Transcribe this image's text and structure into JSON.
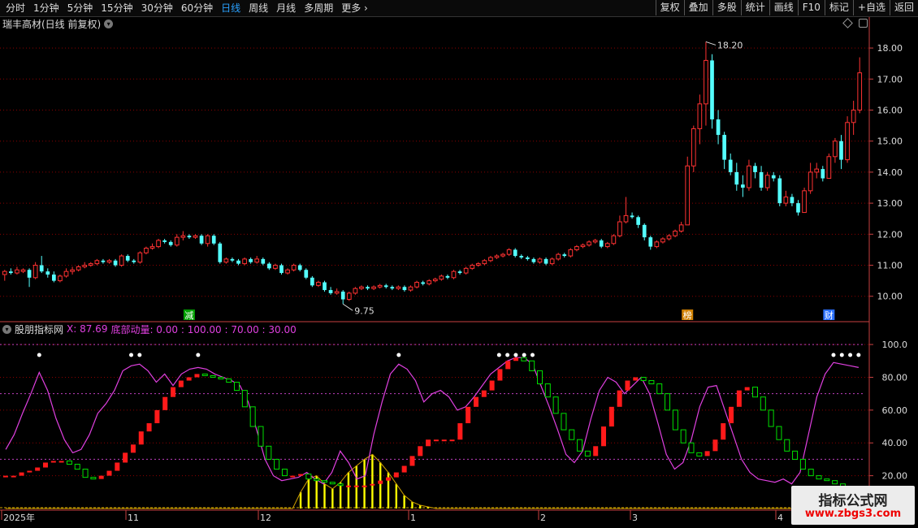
{
  "toolbar": {
    "periods": [
      "分时",
      "1分钟",
      "5分钟",
      "15分钟",
      "30分钟",
      "60分钟",
      "日线",
      "周线",
      "月线",
      "多周期",
      "更多"
    ],
    "active_index": 6,
    "buttons": [
      "复权",
      "叠加",
      "多股",
      "统计",
      "画线",
      "F10",
      "标记",
      "+自选",
      "返回"
    ]
  },
  "stock": {
    "title": "瑞丰高材(日线 前复权)"
  },
  "indicator": {
    "name": "股朋指标网",
    "x_label": "X: 87.69",
    "params_label": "底部动量: 0.00 : 100.00 : 70.00 : 30.00"
  },
  "colors": {
    "up": "#ff3232",
    "down": "#54ffff",
    "green": "#00e000",
    "magenta": "#e040e0",
    "yellow": "#ffff00",
    "grid": "#8b0000",
    "axis": "#c84040"
  },
  "chart_data": [
    {
      "type": "candlestick",
      "title": "瑞丰高材(日线 前复权)",
      "y_ticks": [
        "10.00",
        "11.00",
        "12.00",
        "13.00",
        "14.00",
        "15.00",
        "16.00",
        "17.00",
        "18.00"
      ],
      "ylim": [
        9.6,
        18.5
      ],
      "annotations": {
        "high": "18.20",
        "low": "9.75"
      },
      "markers": [
        "减",
        "榜",
        "财"
      ],
      "candles": [
        [
          10.7,
          10.8,
          10.5,
          10.85
        ],
        [
          10.8,
          10.75,
          10.7,
          10.9
        ],
        [
          10.75,
          10.85,
          10.7,
          10.95
        ],
        [
          10.8,
          10.85,
          10.75,
          10.9
        ],
        [
          10.85,
          10.6,
          10.3,
          10.9
        ],
        [
          10.6,
          11.0,
          10.55,
          11.1
        ],
        [
          11.0,
          10.8,
          10.75,
          11.3
        ],
        [
          10.8,
          10.7,
          10.6,
          10.9
        ],
        [
          10.7,
          10.5,
          10.45,
          10.8
        ],
        [
          10.5,
          10.65,
          10.45,
          10.7
        ],
        [
          10.65,
          10.8,
          10.6,
          10.9
        ],
        [
          10.8,
          10.85,
          10.7,
          10.95
        ],
        [
          10.85,
          10.95,
          10.8,
          11.0
        ],
        [
          10.95,
          11.0,
          10.9,
          11.1
        ],
        [
          11.0,
          11.05,
          10.95,
          11.1
        ],
        [
          11.05,
          11.15,
          11.0,
          11.2
        ],
        [
          11.15,
          11.1,
          11.05,
          11.2
        ],
        [
          11.1,
          11.15,
          11.05,
          11.2
        ],
        [
          11.15,
          11.0,
          10.95,
          11.2
        ],
        [
          11.0,
          11.3,
          10.95,
          11.35
        ],
        [
          11.3,
          11.15,
          11.1,
          11.35
        ],
        [
          11.15,
          11.1,
          11.05,
          11.2
        ],
        [
          11.1,
          11.4,
          11.05,
          11.45
        ],
        [
          11.4,
          11.55,
          11.35,
          11.6
        ],
        [
          11.55,
          11.6,
          11.5,
          11.7
        ],
        [
          11.6,
          11.8,
          11.55,
          11.85
        ],
        [
          11.8,
          11.75,
          11.7,
          11.85
        ],
        [
          11.75,
          11.65,
          11.6,
          11.8
        ],
        [
          11.65,
          11.9,
          11.6,
          12.0
        ],
        [
          11.9,
          11.95,
          11.8,
          12.1
        ],
        [
          11.95,
          11.9,
          11.85,
          12.0
        ],
        [
          11.9,
          11.95,
          11.85,
          12.0
        ],
        [
          11.95,
          11.7,
          11.65,
          12.0
        ],
        [
          11.7,
          11.95,
          11.6,
          12.0
        ],
        [
          11.95,
          11.7,
          11.65,
          12.0
        ],
        [
          11.7,
          11.1,
          11.05,
          11.75
        ],
        [
          11.1,
          11.2,
          11.05,
          11.25
        ],
        [
          11.2,
          11.15,
          11.1,
          11.25
        ],
        [
          11.15,
          11.05,
          11.0,
          11.2
        ],
        [
          11.05,
          11.2,
          11.0,
          11.25
        ],
        [
          11.2,
          11.1,
          11.05,
          11.25
        ],
        [
          11.1,
          11.2,
          11.05,
          11.3
        ],
        [
          11.2,
          11.05,
          11.0,
          11.25
        ],
        [
          11.05,
          10.9,
          10.85,
          11.1
        ],
        [
          10.9,
          11.0,
          10.85,
          11.05
        ],
        [
          11.0,
          10.75,
          10.7,
          11.05
        ],
        [
          10.75,
          10.85,
          10.7,
          10.9
        ],
        [
          10.85,
          11.0,
          10.8,
          11.05
        ],
        [
          11.0,
          10.85,
          10.8,
          11.05
        ],
        [
          10.85,
          10.6,
          10.55,
          10.9
        ],
        [
          10.6,
          10.35,
          10.3,
          10.65
        ],
        [
          10.35,
          10.45,
          10.3,
          10.5
        ],
        [
          10.45,
          10.2,
          10.15,
          10.5
        ],
        [
          10.2,
          10.1,
          10.05,
          10.3
        ],
        [
          10.1,
          10.15,
          10.05,
          10.25
        ],
        [
          10.15,
          9.9,
          9.75,
          10.2
        ],
        [
          9.9,
          10.1,
          9.85,
          10.15
        ],
        [
          10.1,
          10.25,
          10.05,
          10.3
        ],
        [
          10.25,
          10.3,
          10.2,
          10.35
        ],
        [
          10.3,
          10.25,
          10.2,
          10.35
        ],
        [
          10.25,
          10.3,
          10.2,
          10.35
        ],
        [
          10.3,
          10.35,
          10.25,
          10.4
        ],
        [
          10.35,
          10.3,
          10.25,
          10.4
        ],
        [
          10.3,
          10.25,
          10.2,
          10.35
        ],
        [
          10.25,
          10.3,
          10.2,
          10.35
        ],
        [
          10.3,
          10.2,
          10.15,
          10.35
        ],
        [
          10.2,
          10.3,
          10.15,
          10.35
        ],
        [
          10.3,
          10.45,
          10.25,
          10.5
        ],
        [
          10.45,
          10.4,
          10.35,
          10.5
        ],
        [
          10.4,
          10.5,
          10.35,
          10.55
        ],
        [
          10.5,
          10.55,
          10.45,
          10.6
        ],
        [
          10.55,
          10.65,
          10.5,
          10.7
        ],
        [
          10.65,
          10.6,
          10.55,
          10.7
        ],
        [
          10.6,
          10.8,
          10.55,
          10.85
        ],
        [
          10.8,
          10.75,
          10.7,
          10.85
        ],
        [
          10.75,
          10.9,
          10.7,
          10.95
        ],
        [
          10.9,
          11.0,
          10.85,
          11.05
        ],
        [
          11.0,
          11.05,
          10.95,
          11.1
        ],
        [
          11.05,
          11.15,
          11.0,
          11.2
        ],
        [
          11.15,
          11.25,
          11.1,
          11.3
        ],
        [
          11.25,
          11.3,
          11.2,
          11.35
        ],
        [
          11.3,
          11.35,
          11.25,
          11.4
        ],
        [
          11.35,
          11.5,
          11.3,
          11.55
        ],
        [
          11.5,
          11.3,
          11.25,
          11.55
        ],
        [
          11.3,
          11.25,
          11.2,
          11.35
        ],
        [
          11.25,
          11.2,
          11.15,
          11.3
        ],
        [
          11.2,
          11.1,
          11.05,
          11.25
        ],
        [
          11.1,
          11.2,
          11.05,
          11.25
        ],
        [
          11.2,
          11.05,
          11.0,
          11.25
        ],
        [
          11.05,
          11.2,
          11.0,
          11.25
        ],
        [
          11.2,
          11.35,
          11.15,
          11.4
        ],
        [
          11.35,
          11.3,
          11.25,
          11.4
        ],
        [
          11.3,
          11.5,
          11.25,
          11.55
        ],
        [
          11.5,
          11.6,
          11.45,
          11.65
        ],
        [
          11.6,
          11.65,
          11.55,
          11.7
        ],
        [
          11.65,
          11.75,
          11.6,
          11.8
        ],
        [
          11.75,
          11.8,
          11.7,
          11.85
        ],
        [
          11.8,
          11.6,
          11.55,
          11.85
        ],
        [
          11.6,
          11.7,
          11.55,
          11.75
        ],
        [
          11.7,
          11.95,
          11.65,
          12.0
        ],
        [
          11.95,
          12.4,
          11.9,
          12.6
        ],
        [
          12.4,
          12.6,
          12.35,
          13.2
        ],
        [
          12.6,
          12.55,
          12.5,
          12.7
        ],
        [
          12.55,
          12.3,
          12.2,
          12.6
        ],
        [
          12.3,
          11.9,
          11.8,
          12.35
        ],
        [
          11.9,
          11.6,
          11.5,
          11.95
        ],
        [
          11.6,
          11.75,
          11.55,
          11.8
        ],
        [
          11.75,
          11.85,
          11.7,
          11.9
        ],
        [
          11.85,
          11.95,
          11.8,
          12.0
        ],
        [
          11.95,
          12.1,
          11.9,
          12.15
        ],
        [
          12.1,
          12.3,
          12.05,
          12.4
        ],
        [
          12.3,
          14.2,
          12.3,
          14.5
        ],
        [
          14.2,
          15.4,
          14.0,
          15.5
        ],
        [
          15.4,
          16.2,
          14.9,
          16.5
        ],
        [
          16.2,
          17.6,
          15.5,
          18.2
        ],
        [
          17.6,
          15.7,
          15.4,
          17.8
        ],
        [
          15.7,
          15.2,
          14.9,
          16.0
        ],
        [
          15.2,
          14.4,
          14.1,
          15.3
        ],
        [
          14.4,
          14.0,
          13.9,
          14.6
        ],
        [
          14.0,
          13.6,
          13.4,
          14.3
        ],
        [
          13.6,
          13.5,
          13.2,
          13.9
        ],
        [
          13.5,
          14.2,
          13.4,
          14.4
        ],
        [
          14.2,
          14.0,
          13.8,
          14.3
        ],
        [
          14.0,
          13.5,
          13.4,
          14.2
        ],
        [
          13.5,
          13.9,
          13.4,
          14.0
        ],
        [
          13.9,
          13.8,
          13.7,
          14.0
        ],
        [
          13.8,
          13.0,
          12.9,
          13.9
        ],
        [
          13.0,
          13.2,
          12.9,
          13.4
        ],
        [
          13.2,
          13.0,
          12.9,
          13.3
        ],
        [
          13.0,
          12.7,
          12.6,
          13.1
        ],
        [
          12.7,
          13.4,
          12.7,
          13.5
        ],
        [
          13.4,
          14.0,
          13.3,
          14.3
        ],
        [
          14.0,
          14.1,
          13.8,
          14.3
        ],
        [
          14.1,
          13.8,
          13.7,
          14.2
        ],
        [
          13.8,
          14.5,
          13.8,
          14.6
        ],
        [
          14.5,
          15.0,
          14.3,
          15.1
        ],
        [
          15.0,
          14.4,
          14.1,
          15.2
        ],
        [
          14.4,
          15.6,
          14.3,
          15.8
        ],
        [
          15.6,
          16.0,
          15.2,
          16.3
        ],
        [
          16.0,
          17.2,
          15.9,
          17.7
        ]
      ]
    },
    {
      "type": "line",
      "title": "股朋指标网",
      "y_ticks": [
        "20.00",
        "40.00",
        "60.00",
        "80.00",
        "100.0"
      ],
      "ylim": [
        0,
        105
      ],
      "x_labels": [
        "2025年",
        "11",
        "12",
        "1",
        "2",
        "3",
        "4"
      ],
      "series": [
        {
          "values": [
            36,
            45,
            58,
            70,
            83,
            72,
            55,
            42,
            34,
            36,
            45,
            58,
            64,
            72,
            84,
            87,
            88,
            84,
            77,
            82,
            75,
            82,
            85,
            86,
            85,
            82,
            80,
            78,
            75,
            65,
            48,
            30,
            20,
            17,
            18,
            19,
            22,
            18,
            15,
            22,
            35,
            28,
            18,
            20,
            45,
            65,
            82,
            88,
            85,
            78,
            65,
            70,
            72,
            68,
            60,
            62,
            68,
            75,
            82,
            86,
            90,
            92,
            92,
            88,
            75,
            62,
            48,
            33,
            28,
            35,
            55,
            72,
            80,
            77,
            70,
            75,
            80,
            70,
            52,
            33,
            24,
            28,
            42,
            62,
            74,
            75,
            60,
            45,
            30,
            22,
            18,
            17,
            16,
            18,
            15,
            22,
            45,
            68,
            82,
            89,
            88,
            87,
            86
          ]
        },
        {
          "values": [
            20,
            20,
            22,
            23,
            25,
            28,
            29,
            29,
            27,
            24,
            19,
            18,
            20,
            23,
            28,
            34,
            39,
            47,
            52,
            60,
            68,
            74,
            78,
            80,
            82,
            81,
            80,
            79,
            77,
            72,
            62,
            50,
            38,
            30,
            24,
            20,
            20,
            21,
            18,
            17,
            16,
            15,
            14,
            14,
            14,
            14,
            15,
            17,
            19,
            22,
            26,
            32,
            38,
            42,
            42,
            42,
            42,
            52,
            62,
            68,
            72,
            78,
            85,
            90,
            92,
            90,
            84,
            76,
            68,
            58,
            48,
            42,
            35,
            32,
            38,
            50,
            62,
            72,
            78,
            80,
            78,
            76,
            70,
            60,
            48,
            40,
            34,
            32,
            35,
            42,
            52,
            62,
            72,
            74,
            68,
            60,
            50,
            42,
            35,
            30,
            24,
            20,
            18,
            17,
            15,
            13,
            12,
            11
          ]
        },
        {
          "values": [
            0,
            0,
            0,
            0,
            0,
            0,
            0,
            0,
            0,
            0,
            0,
            0,
            0,
            0,
            0,
            0,
            0,
            0,
            0,
            0,
            0,
            0,
            0,
            0,
            0,
            0,
            0,
            0,
            0,
            0,
            0,
            0,
            0,
            0,
            0,
            0,
            0,
            10,
            18,
            20,
            15,
            12,
            16,
            22,
            26,
            30,
            33,
            28,
            22,
            15,
            8,
            4,
            2,
            1,
            0,
            0,
            0,
            0,
            0,
            0,
            0,
            0,
            0,
            0,
            0,
            0,
            0,
            0,
            0,
            0,
            0,
            0,
            0,
            0,
            0,
            0,
            0,
            0,
            0,
            0,
            0,
            0,
            0,
            0,
            0,
            0,
            0,
            0,
            0,
            0,
            0,
            0,
            0,
            0,
            0,
            0,
            0,
            0,
            0,
            0,
            0,
            0,
            0,
            0,
            0,
            0,
            0,
            0
          ]
        }
      ]
    }
  ]
}
